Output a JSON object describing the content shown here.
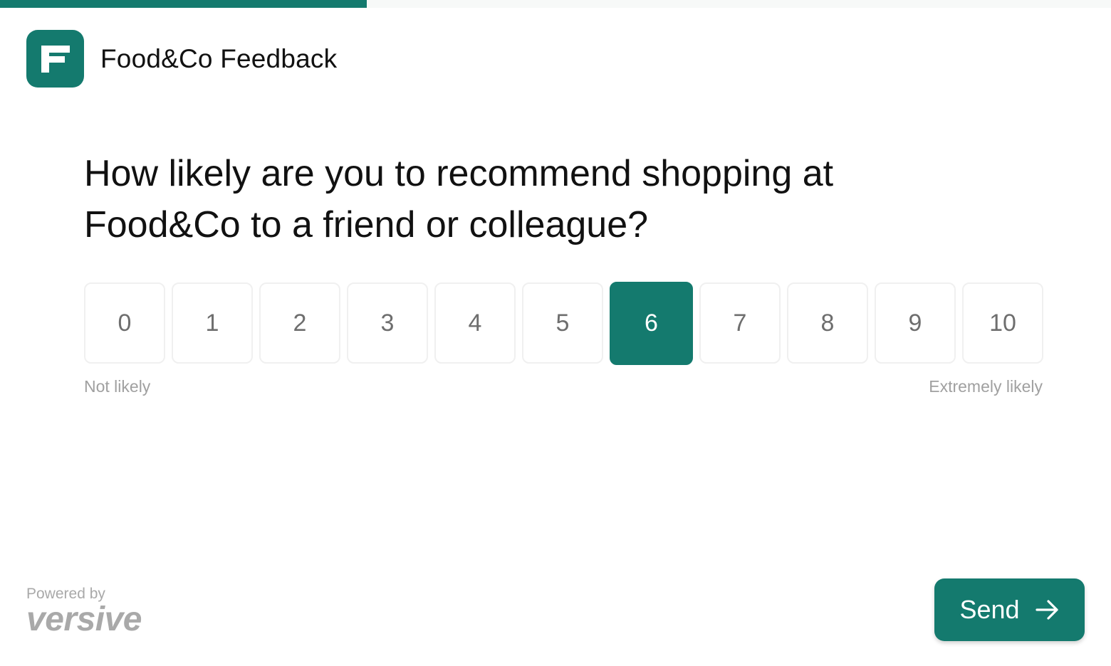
{
  "progress": {
    "fraction": 0.33,
    "color": "#147a6e"
  },
  "brand": {
    "title": "Food&Co Feedback",
    "logo_icon": "f-letter-logo-icon",
    "color": "#147a6e"
  },
  "question": {
    "text": "How likely are you to recommend shopping at Food&Co to a friend or colleague?"
  },
  "scale": {
    "options": [
      "0",
      "1",
      "2",
      "3",
      "4",
      "5",
      "6",
      "7",
      "8",
      "9",
      "10"
    ],
    "selected": "6",
    "low_label": "Not likely",
    "high_label": "Extremely likely"
  },
  "footer": {
    "powered_by": "Powered by",
    "powered_brand": "versive",
    "send_label": "Send",
    "send_icon": "arrow-right-icon"
  }
}
